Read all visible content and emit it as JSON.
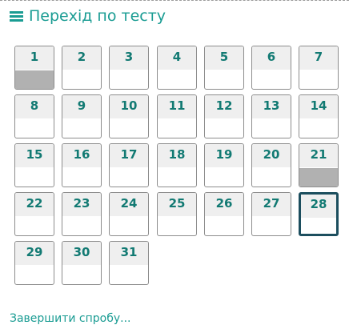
{
  "nav": {
    "title": "Перехід по тесту",
    "icon": "hamburger-icon",
    "finish_label": "Завершити спробу...",
    "accent_color": "#1a9c93"
  },
  "questions": [
    {
      "label": "1",
      "answered": true
    },
    {
      "label": "2",
      "answered": false
    },
    {
      "label": "3",
      "answered": false
    },
    {
      "label": "4",
      "answered": false
    },
    {
      "label": "5",
      "answered": false
    },
    {
      "label": "6",
      "answered": false
    },
    {
      "label": "7",
      "answered": false
    },
    {
      "label": "8",
      "answered": false
    },
    {
      "label": "9",
      "answered": false
    },
    {
      "label": "10",
      "answered": false
    },
    {
      "label": "11",
      "answered": false
    },
    {
      "label": "12",
      "answered": false
    },
    {
      "label": "13",
      "answered": false
    },
    {
      "label": "14",
      "answered": false
    },
    {
      "label": "15",
      "answered": false
    },
    {
      "label": "16",
      "answered": false
    },
    {
      "label": "17",
      "answered": false
    },
    {
      "label": "18",
      "answered": false
    },
    {
      "label": "19",
      "answered": false
    },
    {
      "label": "20",
      "answered": false
    },
    {
      "label": "21",
      "answered": true
    },
    {
      "label": "22",
      "answered": false
    },
    {
      "label": "23",
      "answered": false
    },
    {
      "label": "24",
      "answered": false
    },
    {
      "label": "25",
      "answered": false
    },
    {
      "label": "26",
      "answered": false
    },
    {
      "label": "27",
      "answered": false
    },
    {
      "label": "28",
      "answered": false,
      "current": true
    },
    {
      "label": "29",
      "answered": false
    },
    {
      "label": "30",
      "answered": false
    },
    {
      "label": "31",
      "answered": false
    }
  ]
}
